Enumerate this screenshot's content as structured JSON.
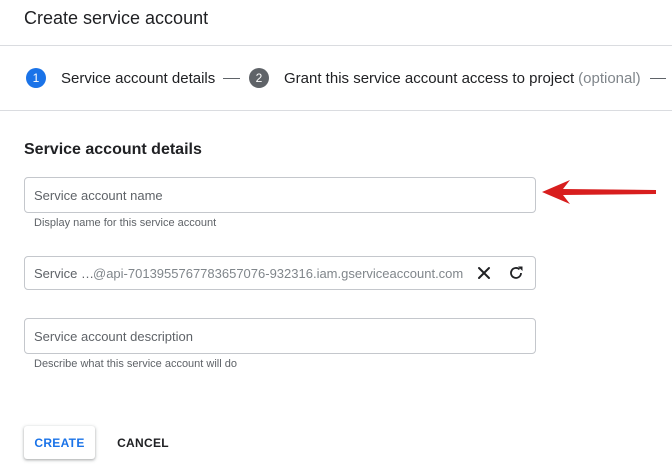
{
  "header": {
    "title": "Create service account"
  },
  "stepper": {
    "steps": [
      {
        "number": "1",
        "label": "Service account details",
        "optional": "",
        "active": true
      },
      {
        "number": "2",
        "label": "Grant this service account access to project",
        "optional": "(optional)",
        "active": false
      }
    ]
  },
  "colors": {
    "active_step": "#1a73e8",
    "inactive_step": "#5f6368",
    "accent": "#1a73e8",
    "annotation_arrow": "#d81e1e"
  },
  "form": {
    "section_title": "Service account details",
    "name_field": {
      "placeholder": "Service account name",
      "value": "",
      "hint": "Display name for this service account"
    },
    "id_field": {
      "prefix": "Service …",
      "suffix": "@api-7013955767783657076-932316.iam.gserviceaccount.com",
      "clear_icon": "close-icon",
      "refresh_icon": "refresh-icon"
    },
    "description_field": {
      "placeholder": "Service account description",
      "value": "",
      "hint": "Describe what this service account will do"
    }
  },
  "actions": {
    "create_label": "CREATE",
    "cancel_label": "CANCEL"
  }
}
